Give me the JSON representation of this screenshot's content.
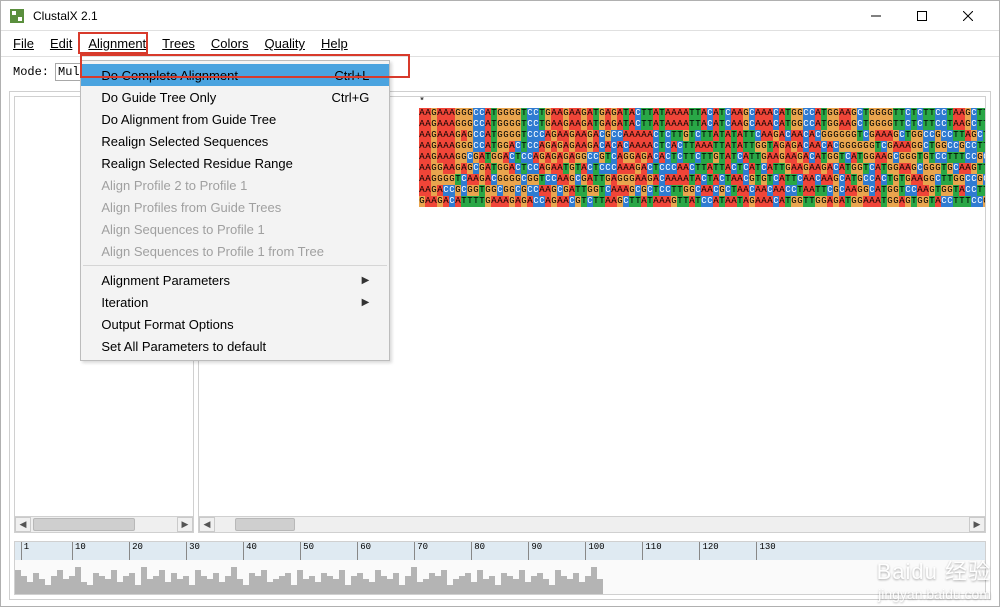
{
  "window": {
    "title": "ClustalX 2.1"
  },
  "menubar": {
    "items": [
      "File",
      "Edit",
      "Alignment",
      "Trees",
      "Colors",
      "Quality",
      "Help"
    ]
  },
  "mode": {
    "label": "Mode:",
    "value": "Mul"
  },
  "dropdown": {
    "items": [
      {
        "label": "Do Complete Alignment",
        "shortcut": "Ctrl+L",
        "disabled": false,
        "highlight": true
      },
      {
        "label": "Do Guide Tree Only",
        "shortcut": "Ctrl+G",
        "disabled": false
      },
      {
        "label": "Do Alignment from Guide Tree",
        "disabled": false
      },
      {
        "label": "Realign Selected Sequences",
        "disabled": false
      },
      {
        "label": "Realign Selected Residue Range",
        "disabled": false
      },
      {
        "label": "Align Profile 2 to Profile 1",
        "disabled": true
      },
      {
        "label": "Align Profiles from Guide Trees",
        "disabled": true
      },
      {
        "label": "Align Sequences to Profile 1",
        "disabled": true
      },
      {
        "label": "Align Sequences to Profile 1 from Tree",
        "disabled": true
      },
      {
        "sep": true
      },
      {
        "label": "Alignment Parameters",
        "submenu": true
      },
      {
        "label": "Iteration",
        "submenu": true
      },
      {
        "label": "Output Format Options"
      },
      {
        "label": "Set All Parameters to default"
      }
    ]
  },
  "seq": {
    "marker": "*",
    "rows": [
      "AAGAAAGGGCCATGGGGTCCTGAAGAAGATGAGATACTTATAAAATTACATCAAGCAAACATGGCCATGGAAGCTGGGGTTCTCTTCCTAAGCTTTC",
      "AAGAAAGGGCCATGGGGTCCTGAAGAAGATGAGATACTTATAAAATTACATCAAGCAAACATGGCCATGGAAGCTGGGGTTCTCTTCCTAAGCTTTC",
      "AAGAAAGAGCCATGGGGTCCCAGAAGAAGACGCCAAAAACTCTTGTCTTATATATTCAAGACAACACGGGGGGTCGAAAGCTGGCCGCCTTAGCTTGCCGCCAAAGG",
      "AAGAAAGGGCCATGGACTCCAGAGAGAAGACACACAAAACTCACTTAAATTATATTGGTAGAGACAACACGGGGGGTCGAAAGGCTGGCCGCCTTTGCCCGCCAAAGC",
      "AAGAAAGGCGATGGACTCCAGAGAGAGGCCGTCAGGAGACACTCTTCTTGTATCATTGAAGAAGACATGGTCATGGAAGCGGGTGTCCTTTCCGCCGGCTCAAAGC",
      "AAGGAAGAGCGATGGACTCCAGAATGTACTCCCAAAGACTCCCAACTTATTACTCATCATTGAAGAAGACATGGTCATGGAAGCGGGTGCAAGTTCCCTCGGCGCAGAAGGC",
      "AAGGGGTCAAGACGGGGCGGTCCAAGCGATTGAGGGAAGACAAAATACTACTAACGTGTCATTCAACAAGCATGCCACTGTGAAGGCTTGGCCGCGTCCCTTCC",
      "AAGACCGCGGTGGCGGCGCCAAGCGATTGGTCAAAGCGCTCCTTGGCAACGCTAACAACAACCTAATTCGCAAGGCATGGTCCAAGTGGTACCTTTGTGATCTTTAAAA",
      "GAAGACATTTTGAAAGAGACCAGAACGTCTTAAGCTTATAAAGTTATCCATAATAGAAACATGGTTGGAGATGGAAATGGAGTGGTACCTTTCCGGTGTTATCTTTAAAA"
    ]
  },
  "ruler": {
    "ticks": [
      1,
      10,
      20,
      30,
      40,
      50,
      60,
      70,
      80,
      90,
      100,
      110,
      120,
      130
    ],
    "hist": [
      8,
      6,
      4,
      7,
      5,
      3,
      6,
      8,
      5,
      6,
      9,
      4,
      3,
      7,
      6,
      5,
      8,
      4,
      6,
      7,
      3,
      9,
      5,
      6,
      8,
      4,
      7,
      5,
      6,
      3,
      8,
      6,
      5,
      7,
      4,
      6,
      9,
      5,
      3,
      7,
      6,
      8,
      4,
      5,
      6,
      7,
      3,
      8,
      5,
      6,
      4,
      7,
      6,
      5,
      8,
      3,
      6,
      7,
      5,
      4,
      8,
      6,
      5,
      7,
      3,
      6,
      9,
      4,
      5,
      7,
      6,
      8,
      3,
      5,
      6,
      7,
      4,
      8,
      5,
      6,
      3,
      7,
      6,
      5,
      8,
      4,
      6,
      7,
      5,
      3,
      8,
      6,
      5,
      7,
      4,
      6,
      9,
      5
    ]
  },
  "watermark": {
    "line1": "Baidu 经验",
    "line2": "jingyan.baidu.com"
  }
}
